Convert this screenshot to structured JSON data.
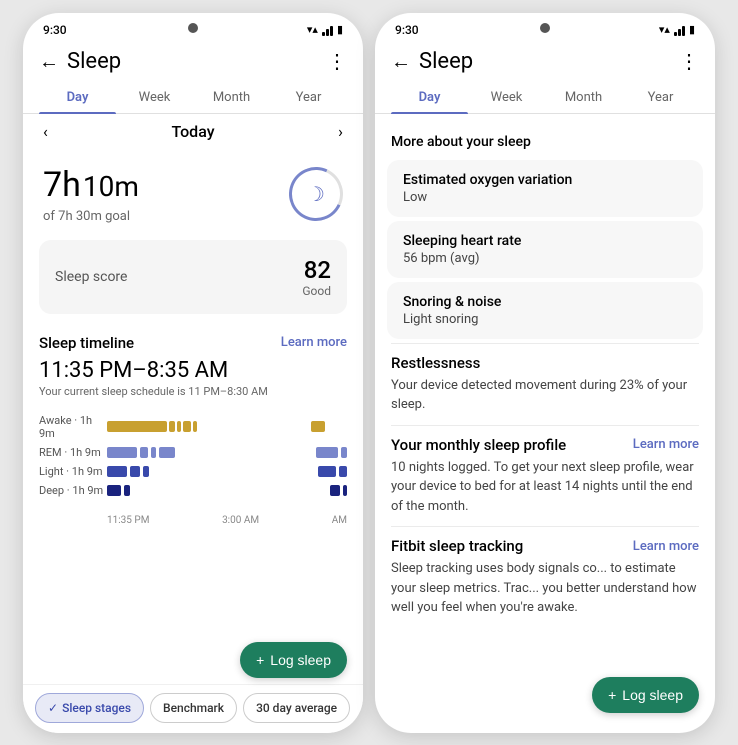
{
  "left_phone": {
    "status_time": "9:30",
    "header_title": "Sleep",
    "tabs": [
      "Day",
      "Week",
      "Month",
      "Year"
    ],
    "active_tab": "Day",
    "nav_prev": "‹",
    "nav_label": "Today",
    "nav_next": "›",
    "duration": "7h 10m",
    "duration_goal": "of 7h 30m goal",
    "sleep_score_label": "Sleep score",
    "sleep_score_value": "82",
    "sleep_score_sub": "Good",
    "timeline_section": "Sleep timeline",
    "learn_more": "Learn more",
    "time_range": "11:35 PM–8:35 AM",
    "schedule_note": "Your current sleep schedule is 11 PM–8:30 AM",
    "timeline": [
      {
        "label": "Awake · 1h 9m",
        "type": "awake"
      },
      {
        "label": "REM · 1h 9m",
        "type": "rem"
      },
      {
        "label": "Light · 1h 9m",
        "type": "light"
      },
      {
        "label": "Deep · 1h 9m",
        "type": "deep"
      }
    ],
    "time_axis": [
      "11:35 PM",
      "3:00 AM",
      "AM"
    ],
    "btn_sleep_stages": "Sleep stages",
    "btn_benchmark": "Benchmark",
    "btn_30day": "30 day average",
    "log_sleep": "Log sleep"
  },
  "right_phone": {
    "status_time": "9:30",
    "header_title": "Sleep",
    "tabs": [
      "Day",
      "Week",
      "Month",
      "Year"
    ],
    "active_tab": "Day",
    "more_about": "More about your sleep",
    "metrics": [
      {
        "title": "Estimated oxygen variation",
        "value": "Low"
      },
      {
        "title": "Sleeping heart rate",
        "value": "56 bpm (avg)"
      },
      {
        "title": "Snoring & noise",
        "value": "Light snoring"
      }
    ],
    "restlessness_title": "Restlessness",
    "restlessness_text": "Your device detected movement during 23% of your sleep.",
    "monthly_title": "Your monthly sleep profile",
    "monthly_learn_more": "Learn more",
    "monthly_text": "10 nights logged. To get your next sleep profile, wear your device to bed for at least 14 nights until the end of the month.",
    "fitbit_title": "Fitbit sleep tracking",
    "fitbit_learn_more": "Learn more",
    "fitbit_text": "Sleep tracking uses body signals co... to estimate your sleep metrics. Trac... you better understand how well you feel when you're awake.",
    "log_sleep": "Log sleep"
  }
}
